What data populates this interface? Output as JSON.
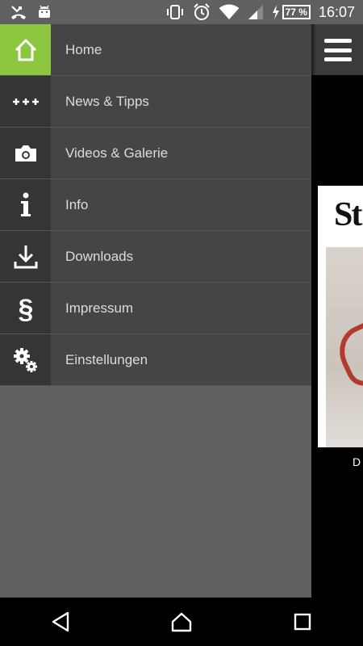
{
  "status_bar": {
    "battery_percent": "77 %",
    "time": "16:07"
  },
  "drawer": {
    "items": [
      {
        "label": "Home",
        "icon": "home-icon",
        "active": true
      },
      {
        "label": "News & Tipps",
        "icon": "plus-plus-plus-icon",
        "active": false
      },
      {
        "label": "Videos & Galerie",
        "icon": "camera-icon",
        "active": false
      },
      {
        "label": "Info",
        "icon": "info-icon",
        "active": false
      },
      {
        "label": "Downloads",
        "icon": "download-icon",
        "active": false
      },
      {
        "label": "Impressum",
        "icon": "section-sign-icon",
        "active": false
      },
      {
        "label": "Einstellungen",
        "icon": "gears-icon",
        "active": false
      }
    ],
    "accent_color": "#8dc63f"
  },
  "background": {
    "magazine_title": "St",
    "magazine_caption": "D"
  },
  "nav_bar": {
    "buttons": [
      "back-icon",
      "home-icon",
      "recents-icon"
    ]
  }
}
